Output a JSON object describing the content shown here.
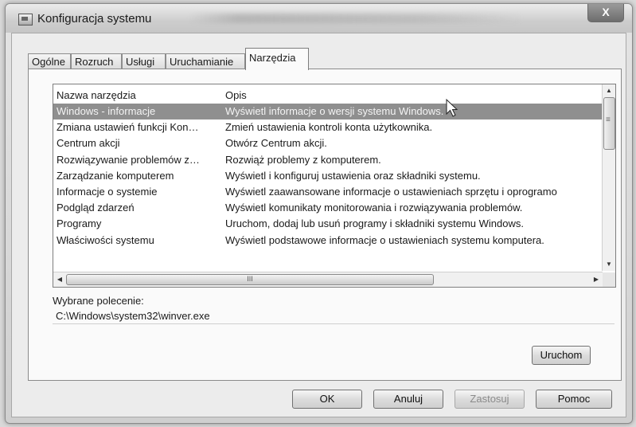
{
  "window": {
    "title": "Konfiguracja systemu",
    "close_label": "X"
  },
  "tabs": [
    {
      "label": "Ogólne"
    },
    {
      "label": "Rozruch"
    },
    {
      "label": "Usługi"
    },
    {
      "label": "Uruchamianie"
    },
    {
      "label": "Narzędzia",
      "active": true
    }
  ],
  "tools_list": {
    "columns": [
      "Nazwa narzędzia",
      "Opis"
    ],
    "selected_index": 0,
    "rows": [
      {
        "name": "Windows - informacje",
        "desc": "Wyświetl informacje o wersji systemu Windows."
      },
      {
        "name": "Zmiana ustawień funkcji Kon…",
        "desc": "Zmień ustawienia kontroli konta użytkownika."
      },
      {
        "name": "Centrum akcji",
        "desc": "Otwórz Centrum akcji."
      },
      {
        "name": "Rozwiązywanie problemów z…",
        "desc": "Rozwiąż problemy z komputerem."
      },
      {
        "name": "Zarządzanie komputerem",
        "desc": "Wyświetl i konfiguruj ustawienia oraz składniki systemu."
      },
      {
        "name": "Informacje o systemie",
        "desc": "Wyświetl zaawansowane informacje o ustawieniach sprzętu i oprogramo"
      },
      {
        "name": "Podgląd zdarzeń",
        "desc": "Wyświetl komunikaty monitorowania i rozwiązywania problemów."
      },
      {
        "name": "Programy",
        "desc": "Uruchom, dodaj lub usuń programy i składniki systemu Windows."
      },
      {
        "name": "Właściwości systemu",
        "desc": "Wyświetl podstawowe informacje o ustawieniach systemu komputera."
      }
    ],
    "hscroll_grip": "III"
  },
  "selected_command": {
    "label": "Wybrane polecenie:",
    "value": "C:\\Windows\\system32\\winver.exe"
  },
  "buttons": {
    "run": "Uruchom",
    "ok": "OK",
    "cancel": "Anuluj",
    "apply": "Zastosuj",
    "help": "Pomoc"
  }
}
